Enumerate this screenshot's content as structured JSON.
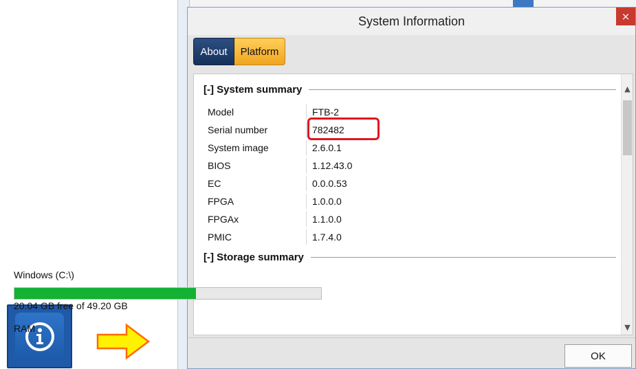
{
  "dialog": {
    "title": "System Information",
    "close_glyph": "×"
  },
  "tabs": [
    {
      "label": "About",
      "selected": true
    },
    {
      "label": "Platform",
      "selected": false
    }
  ],
  "system_summary": {
    "heading": "[-] System summary",
    "rows": [
      {
        "key": "Model",
        "value": "FTB-2"
      },
      {
        "key": "Serial number",
        "value": "782482"
      },
      {
        "key": "System image",
        "value": "2.6.0.1"
      },
      {
        "key": "BIOS",
        "value": "1.12.43.0"
      },
      {
        "key": "EC",
        "value": "0.0.0.53"
      },
      {
        "key": "FPGA",
        "value": "1.0.0.0"
      },
      {
        "key": "FPGAx",
        "value": "1.1.0.0"
      },
      {
        "key": "PMIC",
        "value": "1.7.4.0"
      }
    ]
  },
  "storage_summary": {
    "heading": "[-] Storage summary",
    "drive_label": "Windows (C:\\)",
    "used_fraction": 0.5927,
    "free_text": "20.04 GB free of 49.20 GB",
    "next_label": "RAM"
  },
  "footer": {
    "ok_label": "OK"
  },
  "colors": {
    "tab_about": "#15315c",
    "tab_platform": "#f0a51f",
    "progress_fill": "#13b233",
    "highlight": "#e0151f",
    "arrow": "#fff200",
    "close_button": "#c63a2f"
  },
  "icons": {
    "tile": "info-icon",
    "arrow": "arrow-right-icon"
  }
}
